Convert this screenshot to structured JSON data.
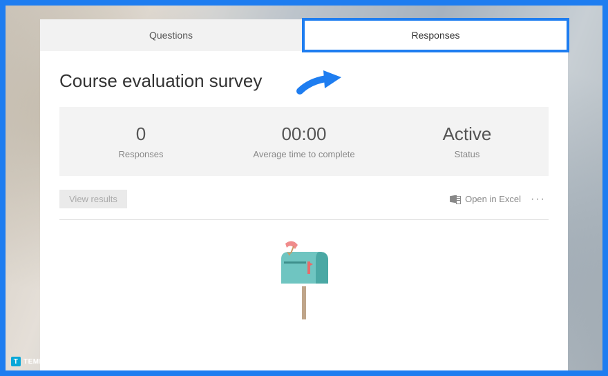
{
  "tabs": {
    "questions": "Questions",
    "responses": "Responses"
  },
  "title": "Course evaluation survey",
  "stats": {
    "responses_value": "0",
    "responses_label": "Responses",
    "avgtime_value": "00:00",
    "avgtime_label": "Average time to complete",
    "status_value": "Active",
    "status_label": "Status"
  },
  "toolbar": {
    "view_results": "View results",
    "open_excel": "Open in Excel"
  },
  "watermark": {
    "letter": "T",
    "text": "TEMPLATE.NET"
  }
}
